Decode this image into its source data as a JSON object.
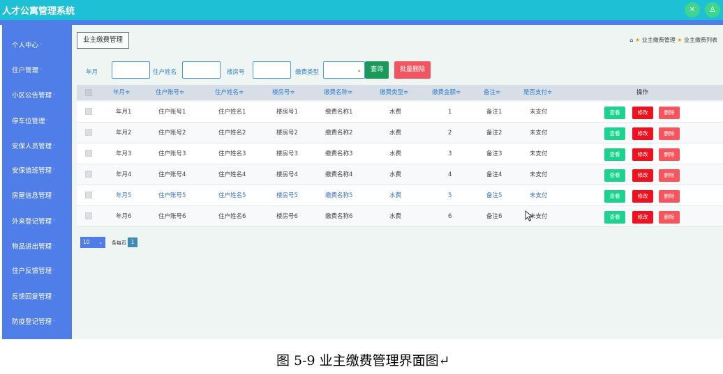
{
  "app": {
    "title": "人才公寓管理系统"
  },
  "topbar": {
    "icons": [
      "close-icon",
      "user-icon"
    ],
    "close_glyph": "✕",
    "user_glyph": "♙"
  },
  "sidebar": {
    "items": [
      {
        "label": "个人中心"
      },
      {
        "label": "住户管理"
      },
      {
        "label": "小区公告管理"
      },
      {
        "label": "停车位管理"
      },
      {
        "label": "安保人员管理"
      },
      {
        "label": "安保值班管理"
      },
      {
        "label": "房屋信息管理"
      },
      {
        "label": "外来登记管理"
      },
      {
        "label": "物品进出管理"
      },
      {
        "label": "住户反馈管理"
      },
      {
        "label": "反馈回复管理"
      },
      {
        "label": "防疫登记管理"
      }
    ],
    "caret": "˅"
  },
  "page": {
    "tab_button": "业主缴费管理",
    "breadcrumb": {
      "home_icon": "⌂",
      "star": "★",
      "level1": "业主缴费管理",
      "level2": "业主缴费列表"
    }
  },
  "filters": {
    "month_label": "年月",
    "name_label": "住户姓名",
    "room_label": "楼房号",
    "type_label": "缴费类型",
    "select_chevron": "⌄",
    "query_button": "查询",
    "batch_delete_button": "批量删除"
  },
  "table": {
    "columns": [
      "年月",
      "住户账号",
      "住户姓名",
      "楼房号",
      "缴费名称",
      "缴费类型",
      "缴费金额",
      "备注",
      "是否支付"
    ],
    "sort_mark": "≑",
    "ops_header": "操作",
    "rows": [
      {
        "cells": [
          "年月1",
          "住户账号1",
          "住户姓名1",
          "楼房号1",
          "缴费名称1",
          "水费",
          "1",
          "备注1",
          "未支付"
        ]
      },
      {
        "cells": [
          "年月2",
          "住户账号2",
          "住户姓名2",
          "楼房号2",
          "缴费名称2",
          "水费",
          "2",
          "备注2",
          "未支付"
        ]
      },
      {
        "cells": [
          "年月3",
          "住户账号3",
          "住户姓名3",
          "楼房号3",
          "缴费名称3",
          "水费",
          "3",
          "备注3",
          "未支付"
        ]
      },
      {
        "cells": [
          "年月4",
          "住户账号4",
          "住户姓名4",
          "楼房号4",
          "缴费名称4",
          "水费",
          "4",
          "备注4",
          "未支付"
        ]
      },
      {
        "cells": [
          "年月5",
          "住户账号5",
          "住户姓名5",
          "楼房号5",
          "缴费名称5",
          "水费",
          "5",
          "备注5",
          "未支付"
        ]
      },
      {
        "cells": [
          "年月6",
          "住户账号6",
          "住户姓名6",
          "楼房号6",
          "缴费名称6",
          "水费",
          "6",
          "备注6",
          "未支付"
        ]
      }
    ],
    "actions": {
      "view": "查看",
      "edit": "修改",
      "delete": "删除"
    }
  },
  "pagination": {
    "page_size": "10",
    "page_size_chevron": "⌄",
    "per_page_label": "条每页",
    "current_page": "1"
  },
  "caption": "图 5-9 业主缴费管理界面图↵"
}
